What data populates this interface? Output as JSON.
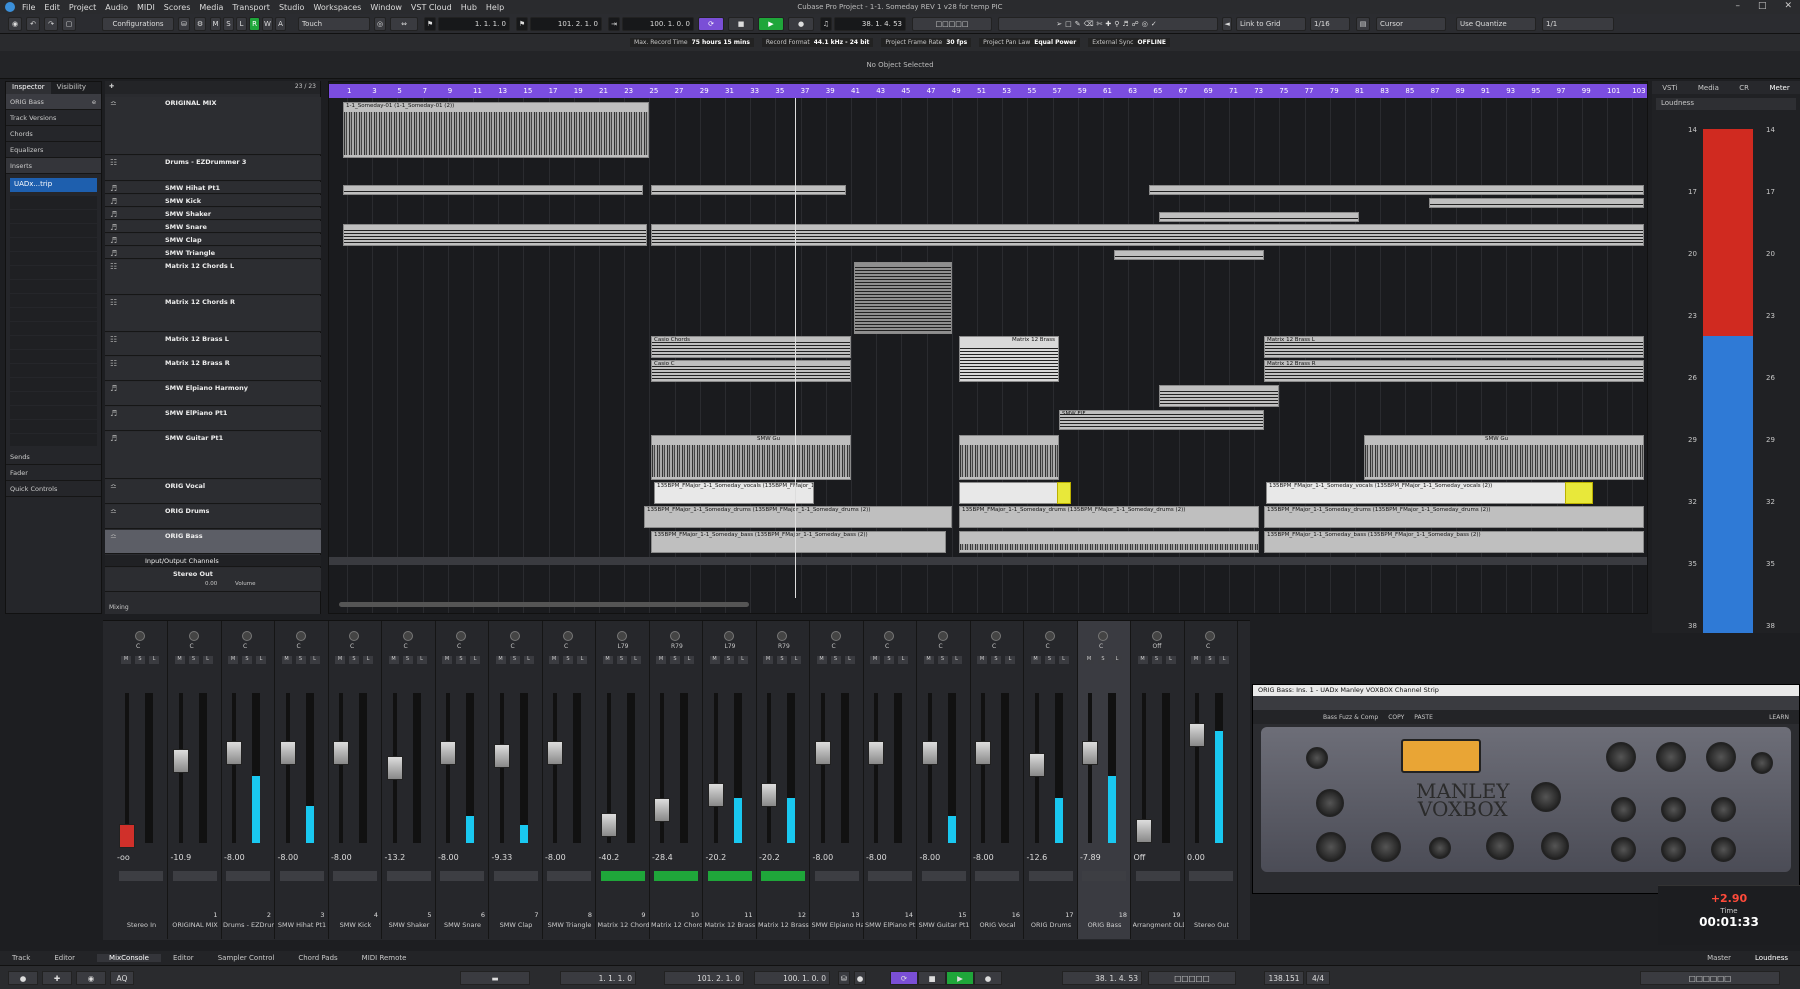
{
  "window": {
    "title": "Cubase Pro Project - 1-1. Someday REV 1 v28 for temp PIC",
    "menu": [
      "File",
      "Edit",
      "Project",
      "Audio",
      "MIDI",
      "Scores",
      "Media",
      "Transport",
      "Studio",
      "Workspaces",
      "Window",
      "VST Cloud",
      "Hub",
      "Help"
    ]
  },
  "toolbar": {
    "configurations": "Configurations",
    "mode_letters": [
      "M",
      "S",
      "L",
      "R",
      "W",
      "A"
    ],
    "automation_mode": "Touch",
    "left_locator": "1. 1. 1. 0",
    "right_locator": "101. 2. 1. 0",
    "punch_pos": "100. 1. 0. 0",
    "position": "38. 1. 4. 53",
    "snap_type": "Link to Grid",
    "snap_value": "1/16",
    "cursor": "Cursor",
    "quantize": "Use Quantize",
    "quantize_value": "1/1"
  },
  "status_line": [
    {
      "label": "Max. Record Time",
      "value": "75 hours 15 mins"
    },
    {
      "label": "Record Format",
      "value": "44.1 kHz - 24 bit"
    },
    {
      "label": "Project Frame Rate",
      "value": "30 fps"
    },
    {
      "label": "Project Pan Law",
      "value": "Equal Power"
    },
    {
      "label": "External Sync",
      "value": "OFFLINE"
    }
  ],
  "info_line": "No Object Selected",
  "inspector": {
    "tabs": [
      "Inspector",
      "Visibility"
    ],
    "track_name": "ORIG Bass",
    "sections": [
      "Track Versions",
      "Chords",
      "Equalizers",
      "Inserts"
    ],
    "insert": "UADx...trip",
    "bottom_sections": [
      "Sends",
      "Fader",
      "Quick Controls"
    ]
  },
  "tracklist": {
    "counter": "23 / 23",
    "tracks": [
      "ORIGINAL MIX",
      "Drums - EZDrummer 3",
      "SMW Hihat Pt1",
      "SMW Kick",
      "SMW Shaker",
      "SMW Snare",
      "SMW Clap",
      "SMW Triangle",
      "Matrix 12 Chords L",
      "Matrix 12 Chords R",
      "Matrix 12 Brass L",
      "Matrix 12 Brass R",
      "SMW Elpiano Harmony",
      "SMW ElPiano Pt1",
      "SMW Guitar Pt1",
      "ORIG Vocal",
      "ORIG Drums",
      "ORIG Bass"
    ],
    "io_folder": "Input/Output Channels",
    "stereo_out": "Stereo Out",
    "volume_value": "0.00",
    "volume_label": "Volume",
    "footer": "Mixing"
  },
  "ruler": [
    "1",
    "3",
    "5",
    "7",
    "9",
    "11",
    "13",
    "15",
    "17",
    "19",
    "21",
    "23",
    "25",
    "27",
    "29",
    "31",
    "33",
    "35",
    "37",
    "39",
    "41",
    "43",
    "45",
    "47",
    "49",
    "51",
    "53",
    "55",
    "57",
    "59",
    "61",
    "63",
    "65",
    "67",
    "69",
    "71",
    "73",
    "75",
    "77",
    "79",
    "81",
    "83",
    "85",
    "87",
    "89",
    "91",
    "93",
    "95",
    "97",
    "99",
    "101",
    "103"
  ],
  "clips": {
    "original_mix": "1-1_Someday-01 (1-1_Someday-01 (2))",
    "casio": "Casio C",
    "casio_chords": "Casio Chords",
    "matrix_brass": "Matrix 12 Brass",
    "matrix_brass_l": "Matrix 12 Brass L",
    "matrix_brass_r": "Matrix 12 Brass R",
    "smw_elf": "SMW ElF",
    "smw_gu": "SMW Gu",
    "vocals": "135BPM_FMajor_1-1_Someday_vocals (135BPM_FMajor_1-1_Someday_vocals (2))",
    "drums": "135BPM_FMajor_1-1_Someday_drums (135BPM_FMajor_1-1_Someday_drums (2))",
    "bass": "135BPM_FMajor_1-1_Someday_bass (135BPM_FMajor_1-1_Someday_bass (2))"
  },
  "right_zone": {
    "tabs": [
      "VSTi",
      "Media",
      "CR",
      "Meter"
    ],
    "section": "Loudness",
    "scale": [
      "14",
      "17",
      "20",
      "23",
      "26",
      "29",
      "32",
      "35",
      "38"
    ],
    "loud_value": "+2.90",
    "time_label": "Time",
    "time_value": "00:01:33"
  },
  "mixer": {
    "channels": [
      {
        "name": "Stereo In",
        "vol": "-oo",
        "num": "",
        "pan": "C",
        "meter": 0.0,
        "fader": 0.05,
        "red": true
      },
      {
        "name": "ORIGINAL MIX",
        "vol": "-10.9",
        "num": "1",
        "pan": "C",
        "meter": 0.0,
        "fader": 0.55
      },
      {
        "name": "Drums - EZDrummer 3",
        "vol": "-8.00",
        "num": "2",
        "pan": "C",
        "meter": 0.45,
        "fader": 0.6
      },
      {
        "name": "SMW Hihat Pt1",
        "vol": "-8.00",
        "num": "3",
        "pan": "C",
        "meter": 0.25,
        "fader": 0.6
      },
      {
        "name": "SMW Kick",
        "vol": "-8.00",
        "num": "4",
        "pan": "C",
        "meter": 0.0,
        "fader": 0.6
      },
      {
        "name": "SMW Shaker",
        "vol": "-13.2",
        "num": "5",
        "pan": "C",
        "meter": 0.0,
        "fader": 0.5
      },
      {
        "name": "SMW Snare",
        "vol": "-8.00",
        "num": "6",
        "pan": "C",
        "meter": 0.18,
        "fader": 0.6
      },
      {
        "name": "SMW Clap",
        "vol": "-9.33",
        "num": "7",
        "pan": "C",
        "meter": 0.12,
        "fader": 0.58
      },
      {
        "name": "SMW Triangle",
        "vol": "-8.00",
        "num": "8",
        "pan": "C",
        "meter": 0.0,
        "fader": 0.6
      },
      {
        "name": "Matrix 12 Chords L",
        "vol": "-40.2",
        "num": "9",
        "pan": "L79",
        "meter": 0.0,
        "fader": 0.12,
        "green": true
      },
      {
        "name": "Matrix 12 Chords R",
        "vol": "-28.4",
        "num": "10",
        "pan": "R79",
        "meter": 0.0,
        "fader": 0.22,
        "green": true
      },
      {
        "name": "Matrix 12 Brass L",
        "vol": "-20.2",
        "num": "11",
        "pan": "L79",
        "meter": 0.3,
        "fader": 0.32,
        "green": true
      },
      {
        "name": "Matrix 12 Brass R",
        "vol": "-20.2",
        "num": "12",
        "pan": "R79",
        "meter": 0.3,
        "fader": 0.32,
        "green": true
      },
      {
        "name": "SMW Elpiano Harmony",
        "vol": "-8.00",
        "num": "13",
        "pan": "C",
        "meter": 0.0,
        "fader": 0.6
      },
      {
        "name": "SMW ElPiano Pt1",
        "vol": "-8.00",
        "num": "14",
        "pan": "C",
        "meter": 0.0,
        "fader": 0.6
      },
      {
        "name": "SMW Guitar Pt1",
        "vol": "-8.00",
        "num": "15",
        "pan": "C",
        "meter": 0.18,
        "fader": 0.6
      },
      {
        "name": "ORIG Vocal",
        "vol": "-8.00",
        "num": "16",
        "pan": "C",
        "meter": 0.0,
        "fader": 0.6
      },
      {
        "name": "ORIG Drums",
        "vol": "-12.6",
        "num": "17",
        "pan": "C",
        "meter": 0.3,
        "fader": 0.52
      },
      {
        "name": "ORIG Bass",
        "vol": "-7.89",
        "num": "18",
        "pan": "C",
        "meter": 0.45,
        "fader": 0.6,
        "sel": true
      },
      {
        "name": "Arrangment OLD",
        "vol": "Off",
        "num": "19",
        "pan": "Off",
        "meter": 0.0,
        "fader": 0.08
      },
      {
        "name": "Stereo Out",
        "vol": "0.00",
        "num": "",
        "pan": "C",
        "meter": 0.75,
        "fader": 0.72
      }
    ]
  },
  "plugin": {
    "title": "ORIG Bass: Ins. 1 - UADx Manley VOXBOX Channel Strip",
    "preset": "Bass Fuzz & Comp",
    "copy": "COPY",
    "paste": "PASTE",
    "learn": "LEARN",
    "brand": "MANLEY",
    "model": "VOXBOX"
  },
  "bottom_tabs": [
    "Track",
    "Editor",
    "MixConsole",
    "Editor",
    "Sampler Control",
    "Chord Pads",
    "MIDI Remote"
  ],
  "bottom_right_tabs": [
    "Master",
    "Loudness"
  ],
  "transport": {
    "aq": "AQ",
    "left": "1. 1. 1. 0",
    "right": "101. 2. 1. 0",
    "punch": "100. 1. 0. 0",
    "pos": "38. 1. 4. 53",
    "tempo": "138.151",
    "sig": "4/4"
  }
}
